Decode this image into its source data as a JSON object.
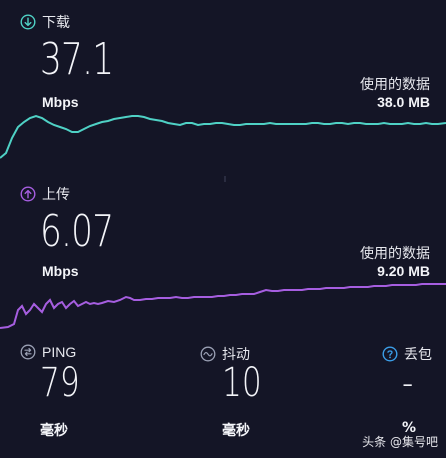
{
  "download": {
    "label": "下载",
    "value": "37.1",
    "unit": "Mbps",
    "used_label": "使用的数据",
    "used_value": "38.0 MB",
    "color": "#4fd1c5"
  },
  "upload": {
    "label": "上传",
    "value": "6.07",
    "unit": "Mbps",
    "used_label": "使用的数据",
    "used_value": "9.20 MB",
    "color": "#a65ee0"
  },
  "stats": {
    "ping": {
      "label": "PING",
      "value": "79",
      "unit": "毫秒",
      "icon": "ping-icon"
    },
    "jitter": {
      "label": "抖动",
      "value": "10",
      "unit": "毫秒",
      "icon": "jitter-icon"
    },
    "loss": {
      "label": "丢包",
      "value": "-",
      "unit": "%",
      "icon": "help-icon",
      "color": "#3b9ee8"
    }
  },
  "watermark": "头条 @集号吧"
}
